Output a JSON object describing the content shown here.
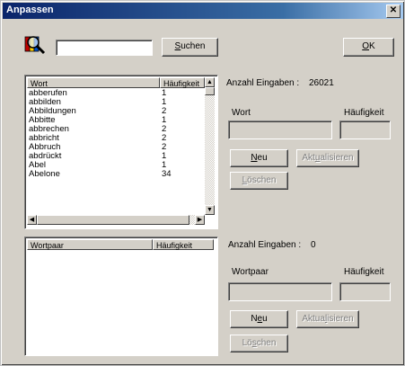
{
  "window": {
    "title": "Anpassen",
    "close_glyph": "✕"
  },
  "search": {
    "value": "",
    "button_label_pre": "",
    "button_label_u": "S",
    "button_label_post": "uchen"
  },
  "ok": {
    "label_u": "O",
    "label_post": "K"
  },
  "word_list": {
    "col_word": "Wort",
    "col_freq": "Häufigkeit",
    "rows": [
      {
        "word": "abberufen",
        "freq": "1"
      },
      {
        "word": "abbilden",
        "freq": "1"
      },
      {
        "word": "Abbildungen",
        "freq": "2"
      },
      {
        "word": "Abbitte",
        "freq": "1"
      },
      {
        "word": "abbrechen",
        "freq": "2"
      },
      {
        "word": "abbricht",
        "freq": "2"
      },
      {
        "word": "Abbruch",
        "freq": "2"
      },
      {
        "word": "abdrückt",
        "freq": "1"
      },
      {
        "word": "Abel",
        "freq": "1"
      },
      {
        "word": "Abelone",
        "freq": "34"
      }
    ]
  },
  "pair_list": {
    "col_pair": "Wortpaar",
    "col_freq": "Häufigkeit"
  },
  "word_panel": {
    "count_label": "Anzahl Eingaben :",
    "count_value": "26021",
    "word_label": "Wort",
    "freq_label": "Häufigkeit",
    "new_u": "N",
    "new_post": "eu",
    "update_pre": "Akt",
    "update_u": "u",
    "update_post": "alisieren",
    "delete_u": "L",
    "delete_post": "öschen"
  },
  "pair_panel": {
    "count_label": "Anzahl Eingaben :",
    "count_value": "0",
    "pair_label": "Wortpaar",
    "freq_label": "Häufigkeit",
    "new_pre": "N",
    "new_u": "e",
    "new_post": "u",
    "update_pre": "Aktua",
    "update_u": "l",
    "update_post": "isieren",
    "delete_pre": "Lö",
    "delete_u": "s",
    "delete_post": "chen"
  },
  "colors": {
    "title_start": "#0a246a",
    "title_end": "#a6caf0",
    "face": "#d4d0c8"
  },
  "icons": {
    "app": "book-magnifier-icon"
  }
}
